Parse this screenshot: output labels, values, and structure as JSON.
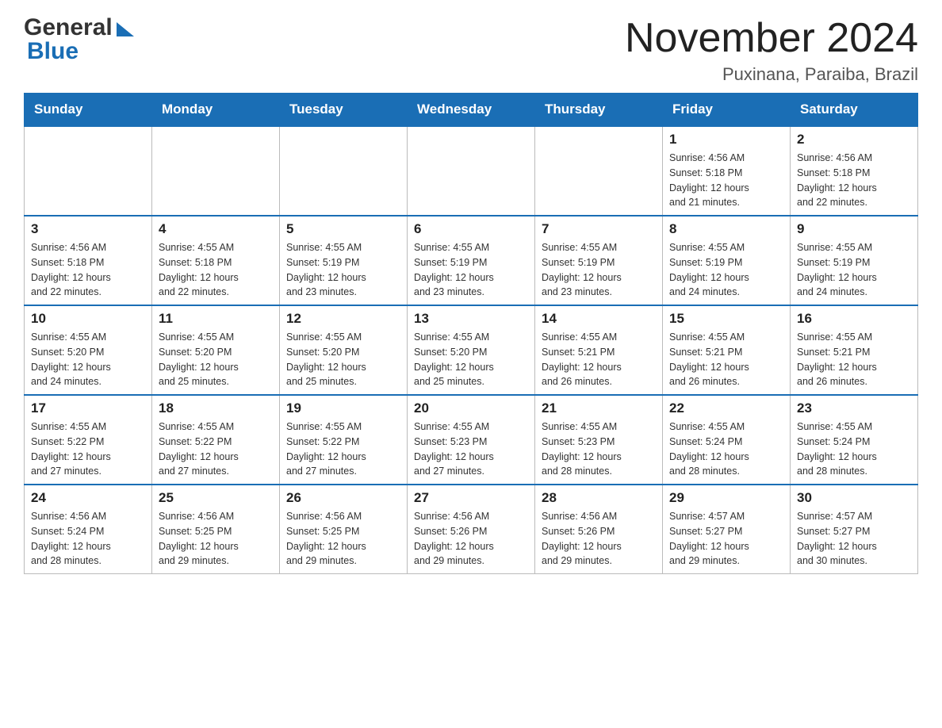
{
  "header": {
    "logo_general": "General",
    "logo_blue": "Blue",
    "title": "November 2024",
    "subtitle": "Puxinana, Paraiba, Brazil"
  },
  "weekdays": [
    "Sunday",
    "Monday",
    "Tuesday",
    "Wednesday",
    "Thursday",
    "Friday",
    "Saturday"
  ],
  "weeks": [
    [
      {
        "day": "",
        "info": ""
      },
      {
        "day": "",
        "info": ""
      },
      {
        "day": "",
        "info": ""
      },
      {
        "day": "",
        "info": ""
      },
      {
        "day": "",
        "info": ""
      },
      {
        "day": "1",
        "info": "Sunrise: 4:56 AM\nSunset: 5:18 PM\nDaylight: 12 hours\nand 21 minutes."
      },
      {
        "day": "2",
        "info": "Sunrise: 4:56 AM\nSunset: 5:18 PM\nDaylight: 12 hours\nand 22 minutes."
      }
    ],
    [
      {
        "day": "3",
        "info": "Sunrise: 4:56 AM\nSunset: 5:18 PM\nDaylight: 12 hours\nand 22 minutes."
      },
      {
        "day": "4",
        "info": "Sunrise: 4:55 AM\nSunset: 5:18 PM\nDaylight: 12 hours\nand 22 minutes."
      },
      {
        "day": "5",
        "info": "Sunrise: 4:55 AM\nSunset: 5:19 PM\nDaylight: 12 hours\nand 23 minutes."
      },
      {
        "day": "6",
        "info": "Sunrise: 4:55 AM\nSunset: 5:19 PM\nDaylight: 12 hours\nand 23 minutes."
      },
      {
        "day": "7",
        "info": "Sunrise: 4:55 AM\nSunset: 5:19 PM\nDaylight: 12 hours\nand 23 minutes."
      },
      {
        "day": "8",
        "info": "Sunrise: 4:55 AM\nSunset: 5:19 PM\nDaylight: 12 hours\nand 24 minutes."
      },
      {
        "day": "9",
        "info": "Sunrise: 4:55 AM\nSunset: 5:19 PM\nDaylight: 12 hours\nand 24 minutes."
      }
    ],
    [
      {
        "day": "10",
        "info": "Sunrise: 4:55 AM\nSunset: 5:20 PM\nDaylight: 12 hours\nand 24 minutes."
      },
      {
        "day": "11",
        "info": "Sunrise: 4:55 AM\nSunset: 5:20 PM\nDaylight: 12 hours\nand 25 minutes."
      },
      {
        "day": "12",
        "info": "Sunrise: 4:55 AM\nSunset: 5:20 PM\nDaylight: 12 hours\nand 25 minutes."
      },
      {
        "day": "13",
        "info": "Sunrise: 4:55 AM\nSunset: 5:20 PM\nDaylight: 12 hours\nand 25 minutes."
      },
      {
        "day": "14",
        "info": "Sunrise: 4:55 AM\nSunset: 5:21 PM\nDaylight: 12 hours\nand 26 minutes."
      },
      {
        "day": "15",
        "info": "Sunrise: 4:55 AM\nSunset: 5:21 PM\nDaylight: 12 hours\nand 26 minutes."
      },
      {
        "day": "16",
        "info": "Sunrise: 4:55 AM\nSunset: 5:21 PM\nDaylight: 12 hours\nand 26 minutes."
      }
    ],
    [
      {
        "day": "17",
        "info": "Sunrise: 4:55 AM\nSunset: 5:22 PM\nDaylight: 12 hours\nand 27 minutes."
      },
      {
        "day": "18",
        "info": "Sunrise: 4:55 AM\nSunset: 5:22 PM\nDaylight: 12 hours\nand 27 minutes."
      },
      {
        "day": "19",
        "info": "Sunrise: 4:55 AM\nSunset: 5:22 PM\nDaylight: 12 hours\nand 27 minutes."
      },
      {
        "day": "20",
        "info": "Sunrise: 4:55 AM\nSunset: 5:23 PM\nDaylight: 12 hours\nand 27 minutes."
      },
      {
        "day": "21",
        "info": "Sunrise: 4:55 AM\nSunset: 5:23 PM\nDaylight: 12 hours\nand 28 minutes."
      },
      {
        "day": "22",
        "info": "Sunrise: 4:55 AM\nSunset: 5:24 PM\nDaylight: 12 hours\nand 28 minutes."
      },
      {
        "day": "23",
        "info": "Sunrise: 4:55 AM\nSunset: 5:24 PM\nDaylight: 12 hours\nand 28 minutes."
      }
    ],
    [
      {
        "day": "24",
        "info": "Sunrise: 4:56 AM\nSunset: 5:24 PM\nDaylight: 12 hours\nand 28 minutes."
      },
      {
        "day": "25",
        "info": "Sunrise: 4:56 AM\nSunset: 5:25 PM\nDaylight: 12 hours\nand 29 minutes."
      },
      {
        "day": "26",
        "info": "Sunrise: 4:56 AM\nSunset: 5:25 PM\nDaylight: 12 hours\nand 29 minutes."
      },
      {
        "day": "27",
        "info": "Sunrise: 4:56 AM\nSunset: 5:26 PM\nDaylight: 12 hours\nand 29 minutes."
      },
      {
        "day": "28",
        "info": "Sunrise: 4:56 AM\nSunset: 5:26 PM\nDaylight: 12 hours\nand 29 minutes."
      },
      {
        "day": "29",
        "info": "Sunrise: 4:57 AM\nSunset: 5:27 PM\nDaylight: 12 hours\nand 29 minutes."
      },
      {
        "day": "30",
        "info": "Sunrise: 4:57 AM\nSunset: 5:27 PM\nDaylight: 12 hours\nand 30 minutes."
      }
    ]
  ]
}
